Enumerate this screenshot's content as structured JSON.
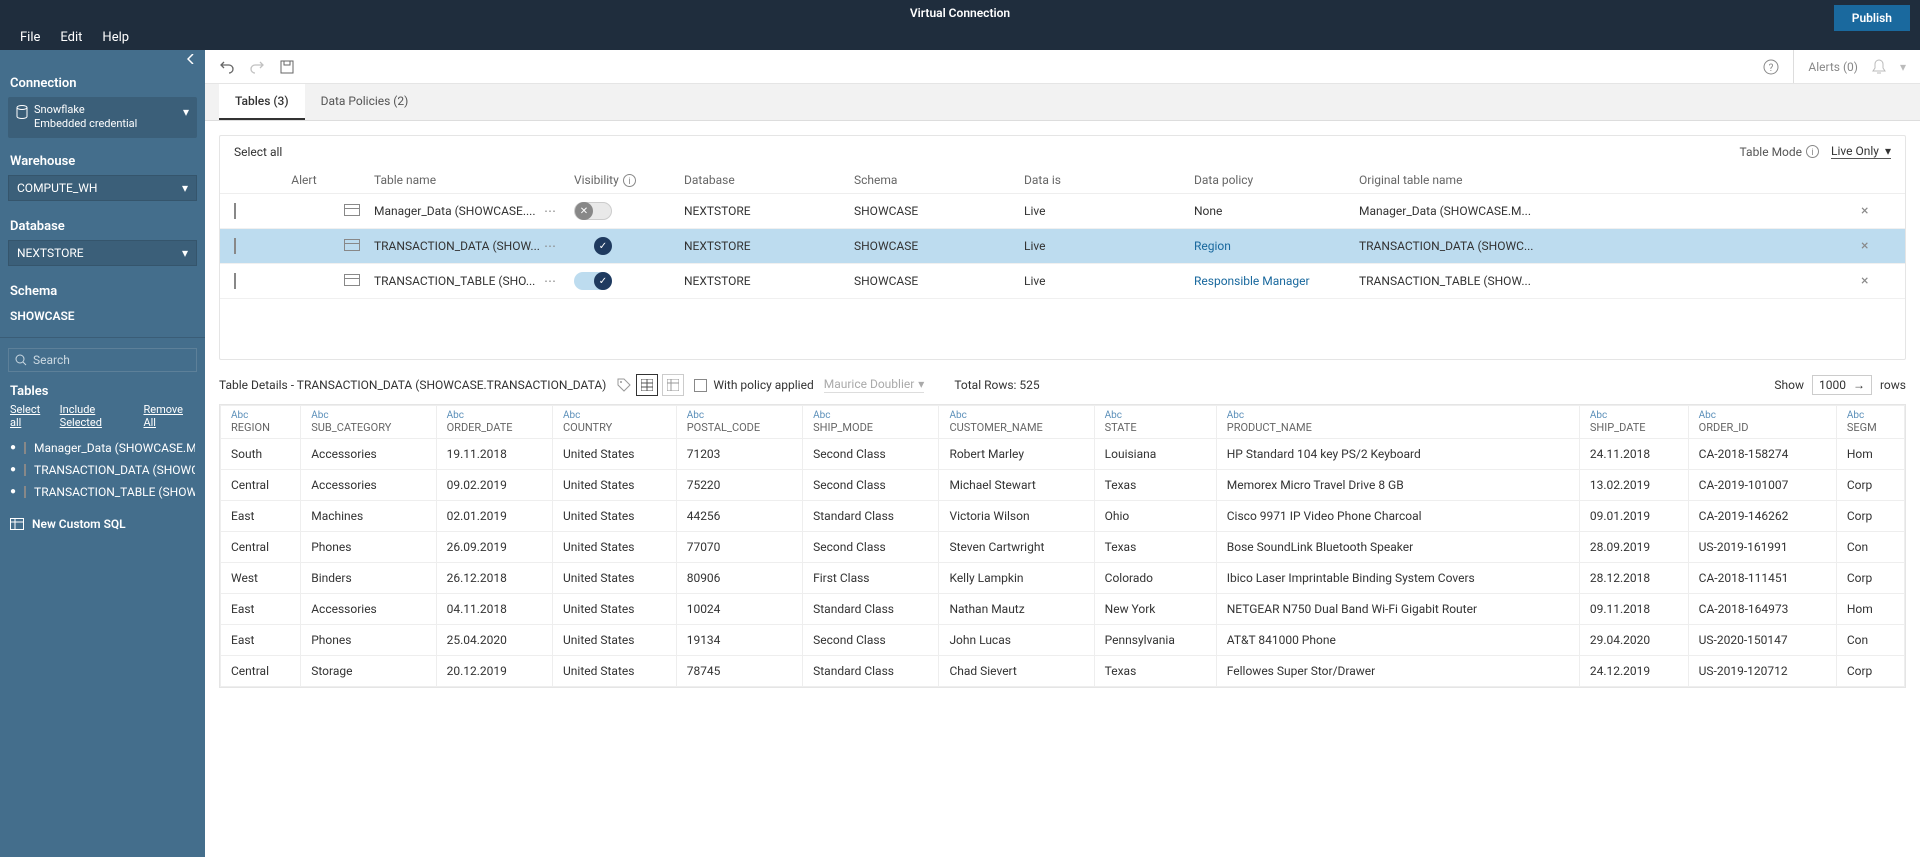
{
  "header": {
    "title": "Virtual Connection",
    "publish": "Publish"
  },
  "menu": {
    "file": "File",
    "edit": "Edit",
    "help": "Help"
  },
  "sidebar": {
    "connection_title": "Connection",
    "conn_type": "Snowflake",
    "conn_cred": "Embedded credential",
    "warehouse_title": "Warehouse",
    "warehouse_value": "COMPUTE_WH",
    "database_title": "Database",
    "database_value": "NEXTSTORE",
    "schema_title": "Schema",
    "schema_value": "SHOWCASE",
    "search_placeholder": "Search",
    "tables_title": "Tables",
    "select_all": "Select all",
    "include_selected": "Include Selected",
    "remove_all": "Remove All",
    "items": [
      "Manager_Data (SHOWCASE.Man...",
      "TRANSACTION_DATA (SHOWCA...",
      "TRANSACTION_TABLE (SHOWC..."
    ],
    "custom_sql": "New Custom SQL"
  },
  "toolbar": {
    "alerts": "Alerts (0)"
  },
  "tabs": {
    "tables": "Tables (3)",
    "policies": "Data Policies (2)"
  },
  "list": {
    "select_all": "Select all",
    "table_mode": "Table Mode",
    "live_only": "Live Only",
    "columns": {
      "alert": "Alert",
      "name": "Table name",
      "visibility": "Visibility",
      "database": "Database",
      "schema": "Schema",
      "datais": "Data is",
      "policy": "Data policy",
      "original": "Original table name"
    },
    "rows": [
      {
        "name": "Manager_Data (SHOWCASE....",
        "vis": false,
        "db": "NEXTSTORE",
        "schema": "SHOWCASE",
        "datais": "Live",
        "policy": "None",
        "policy_link": false,
        "orig": "Manager_Data (SHOWCASE.M...",
        "selected": false
      },
      {
        "name": "TRANSACTION_DATA (SHOW...",
        "vis": true,
        "db": "NEXTSTORE",
        "schema": "SHOWCASE",
        "datais": "Live",
        "policy": "Region",
        "policy_link": true,
        "orig": "TRANSACTION_DATA (SHOWC...",
        "selected": true
      },
      {
        "name": "TRANSACTION_TABLE (SHO...",
        "vis": true,
        "db": "NEXTSTORE",
        "schema": "SHOWCASE",
        "datais": "Live",
        "policy": "Responsible Manager",
        "policy_link": true,
        "orig": "TRANSACTION_TABLE (SHOW...",
        "selected": false
      }
    ]
  },
  "details": {
    "title": "Table Details - TRANSACTION_DATA (SHOWCASE.TRANSACTION_DATA)",
    "with_policy": "With policy applied",
    "user": "Maurice Doublier",
    "total_rows": "Total Rows: 525",
    "show": "Show",
    "show_value": "1000",
    "rows_label": "rows"
  },
  "grid": {
    "type_label": "Abc",
    "columns": [
      "REGION",
      "SUB_CATEGORY",
      "ORDER_DATE",
      "COUNTRY",
      "POSTAL_CODE",
      "SHIP_MODE",
      "CUSTOMER_NAME",
      "STATE",
      "PRODUCT_NAME",
      "SHIP_DATE",
      "ORDER_ID",
      "SEGM"
    ],
    "rows": [
      [
        "South",
        "Accessories",
        "19.11.2018",
        "United States",
        "71203",
        "Second Class",
        "Robert Marley",
        "Louisiana",
        "HP Standard 104 key PS/2 Keyboard",
        "24.11.2018",
        "CA-2018-158274",
        "Hom"
      ],
      [
        "Central",
        "Accessories",
        "09.02.2019",
        "United States",
        "75220",
        "Second Class",
        "Michael Stewart",
        "Texas",
        "Memorex Micro Travel Drive 8 GB",
        "13.02.2019",
        "CA-2019-101007",
        "Corp"
      ],
      [
        "East",
        "Machines",
        "02.01.2019",
        "United States",
        "44256",
        "Standard Class",
        "Victoria Wilson",
        "Ohio",
        "Cisco 9971 IP Video Phone Charcoal",
        "09.01.2019",
        "CA-2019-146262",
        "Corp"
      ],
      [
        "Central",
        "Phones",
        "26.09.2019",
        "United States",
        "77070",
        "Second Class",
        "Steven Cartwright",
        "Texas",
        "Bose SoundLink Bluetooth Speaker",
        "28.09.2019",
        "US-2019-161991",
        "Con"
      ],
      [
        "West",
        "Binders",
        "26.12.2018",
        "United States",
        "80906",
        "First Class",
        "Kelly Lampkin",
        "Colorado",
        "Ibico Laser Imprintable Binding System Covers",
        "28.12.2018",
        "CA-2018-111451",
        "Corp"
      ],
      [
        "East",
        "Accessories",
        "04.11.2018",
        "United States",
        "10024",
        "Standard Class",
        "Nathan Mautz",
        "New York",
        "NETGEAR N750 Dual Band Wi-Fi Gigabit Router",
        "09.11.2018",
        "CA-2018-164973",
        "Hom"
      ],
      [
        "East",
        "Phones",
        "25.04.2020",
        "United States",
        "19134",
        "Second Class",
        "John Lucas",
        "Pennsylvania",
        "AT&T 841000 Phone",
        "29.04.2020",
        "US-2020-150147",
        "Con"
      ],
      [
        "Central",
        "Storage",
        "20.12.2019",
        "United States",
        "78745",
        "Standard Class",
        "Chad Sievert",
        "Texas",
        "Fellowes Super Stor/Drawer",
        "24.12.2019",
        "US-2019-120712",
        "Corp"
      ]
    ]
  }
}
